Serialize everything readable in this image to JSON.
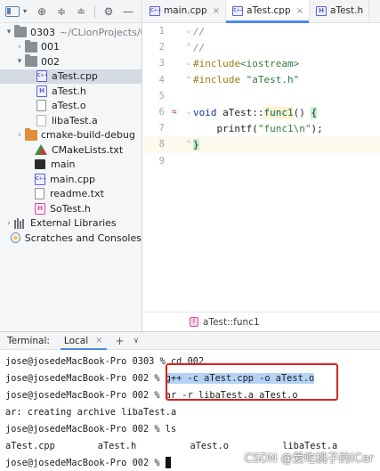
{
  "project_panel": {
    "toolbar_icons": [
      "project-view-icon",
      "chevron-down-icon",
      "locate-icon",
      "expand-all-icon",
      "collapse-all-icon",
      "gear-icon",
      "minimize-icon"
    ],
    "root": {
      "name": "0303",
      "path": "~/CLionProjects/0"
    },
    "items": [
      {
        "label": "001",
        "kind": "folder"
      },
      {
        "label": "002",
        "kind": "folder"
      },
      {
        "label": "aTest.cpp",
        "kind": "cpp"
      },
      {
        "label": "aTest.h",
        "kind": "header"
      },
      {
        "label": "aTest.o",
        "kind": "object"
      },
      {
        "label": "libaTest.a",
        "kind": "archive"
      },
      {
        "label": "cmake-build-debug",
        "kind": "folder-orange"
      },
      {
        "label": "CMakeLists.txt",
        "kind": "cmake"
      },
      {
        "label": "main",
        "kind": "executable"
      },
      {
        "label": "main.cpp",
        "kind": "cpp"
      },
      {
        "label": "readme.txt",
        "kind": "text"
      },
      {
        "label": "SoTest.h",
        "kind": "header-pink"
      },
      {
        "label": "External Libraries",
        "kind": "libraries"
      },
      {
        "label": "Scratches and Consoles",
        "kind": "scratches"
      }
    ]
  },
  "editor": {
    "tabs": [
      {
        "label": "main.cpp",
        "icon": "cpp"
      },
      {
        "label": "aTest.cpp",
        "icon": "cpp"
      },
      {
        "label": "aTest.h",
        "icon": "h"
      }
    ],
    "line_numbers": [
      "1",
      "2",
      "3",
      "4",
      "5",
      "6",
      "7",
      "8",
      "9"
    ],
    "code": {
      "l1": "//",
      "l2": "//",
      "l3_directive": "#include",
      "l3_header": "<iostream>",
      "l4_directive": "#include",
      "l4_header": "\"aTest.h\"",
      "l6_keyword": "void",
      "l6_class": "aTest::",
      "l6_fn": "func1",
      "l6_rest": "() ",
      "l6_brace": "{",
      "l7_indent": "    ",
      "l7_call": "printf(",
      "l7_string": "\"func1\\n\"",
      "l7_end": ");",
      "l8_brace": "}"
    },
    "breadcrumb": {
      "icon": "f",
      "label": "aTest::func1"
    }
  },
  "terminal": {
    "title": "Terminal:",
    "tab_label": "Local",
    "tab_close": "×",
    "add": "+",
    "dropdown": "∨",
    "lines": {
      "l1_prompt": "jose@josedeMacBook-Pro 0303 % ",
      "l1_cmd": "cd 002",
      "l2_prompt": "jose@josedeMacBook-Pro 002 % ",
      "l2_cmd": "g++ -c aTest.cpp -o aTest.o",
      "l3_prompt": "jose@josedeMacBook-Pro 002 % ",
      "l3_cmd": "ar -r libaTest.a aTest.o",
      "l4": "ar: creating archive libaTest.a",
      "l5_prompt": "jose@josedeMacBook-Pro 002 % ",
      "l5_cmd": "ls",
      "files": [
        "aTest.cpp",
        "aTest.h",
        "aTest.o",
        "libaTest.a"
      ],
      "l7_prompt": "jose@josedeMacBook-Pro 002 % "
    },
    "watermark": "CSDN @爱吃桃子的ICer"
  },
  "colors": {
    "selection": "#d5dbe5",
    "accent": "#4b8be8",
    "highlight_box": "#e0211c",
    "command_highlight": "#b3d2f5"
  }
}
